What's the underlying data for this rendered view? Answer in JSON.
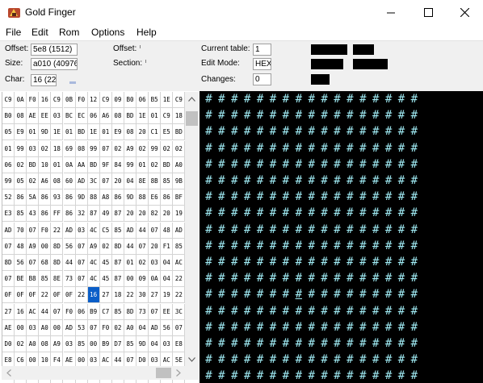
{
  "window": {
    "title": "Gold Finger",
    "minimize_icon": "minimize-icon",
    "maximize_icon": "maximize-icon",
    "close_icon": "close-icon"
  },
  "menu": [
    "File",
    "Edit",
    "Rom",
    "Options",
    "Help"
  ],
  "info": {
    "offset_label": "Offset:",
    "offset_value": "5e8 (1512)",
    "size_label": "Size:",
    "size_value": "a010 (40976)",
    "char_label": "Char:",
    "char_value": "16 (22)",
    "offset2_label": "Offset:",
    "section_label": "Section:",
    "current_table_label": "Current table:",
    "current_table_value": "1",
    "edit_mode_label": "Edit Mode:",
    "edit_mode_value": "HEX",
    "changes_label": "Changes:",
    "changes_value": "0"
  },
  "hex": {
    "rows": [
      [
        "C9",
        "0A",
        "F0",
        "16",
        "C9",
        "0B",
        "F0",
        "12",
        "C9",
        "09",
        "B0",
        "06",
        "B5",
        "1E",
        "C9"
      ],
      [
        "B0",
        "08",
        "AE",
        "EE",
        "03",
        "BC",
        "EC",
        "06",
        "A6",
        "08",
        "BD",
        "1E",
        "01",
        "C9",
        "18"
      ],
      [
        "05",
        "E9",
        "01",
        "9D",
        "1E",
        "01",
        "BD",
        "1E",
        "01",
        "E9",
        "08",
        "20",
        "C1",
        "E5",
        "BD"
      ],
      [
        "01",
        "99",
        "03",
        "02",
        "18",
        "69",
        "08",
        "99",
        "07",
        "02",
        "A9",
        "02",
        "99",
        "02",
        "02"
      ],
      [
        "06",
        "02",
        "BD",
        "10",
        "01",
        "0A",
        "AA",
        "BD",
        "9F",
        "84",
        "99",
        "01",
        "02",
        "BD",
        "A0"
      ],
      [
        "99",
        "05",
        "02",
        "A6",
        "08",
        "60",
        "AD",
        "3C",
        "07",
        "20",
        "04",
        "8E",
        "8B",
        "85",
        "9B"
      ],
      [
        "52",
        "86",
        "5A",
        "86",
        "93",
        "86",
        "9D",
        "88",
        "A8",
        "86",
        "9D",
        "88",
        "E6",
        "86",
        "BF"
      ],
      [
        "E3",
        "85",
        "43",
        "86",
        "FF",
        "86",
        "32",
        "87",
        "49",
        "87",
        "20",
        "20",
        "82",
        "20",
        "19"
      ],
      [
        "AD",
        "70",
        "07",
        "F0",
        "22",
        "AD",
        "03",
        "4C",
        "C5",
        "85",
        "AD",
        "44",
        "07",
        "48",
        "AD"
      ],
      [
        "07",
        "48",
        "A9",
        "00",
        "8D",
        "56",
        "07",
        "A9",
        "02",
        "8D",
        "44",
        "07",
        "20",
        "F1",
        "85"
      ],
      [
        "8D",
        "56",
        "07",
        "68",
        "8D",
        "44",
        "07",
        "4C",
        "45",
        "87",
        "01",
        "02",
        "03",
        "04",
        "AC"
      ],
      [
        "07",
        "BE",
        "B8",
        "85",
        "8E",
        "73",
        "07",
        "4C",
        "45",
        "87",
        "00",
        "09",
        "0A",
        "04",
        "22"
      ],
      [
        "0F",
        "0F",
        "0F",
        "22",
        "0F",
        "0F",
        "22",
        "16",
        "27",
        "18",
        "22",
        "30",
        "27",
        "19",
        "22"
      ],
      [
        "27",
        "16",
        "AC",
        "44",
        "07",
        "F0",
        "06",
        "B9",
        "C7",
        "85",
        "8D",
        "73",
        "07",
        "EE",
        "3C"
      ],
      [
        "AE",
        "00",
        "03",
        "A0",
        "00",
        "AD",
        "53",
        "07",
        "F0",
        "02",
        "A0",
        "04",
        "AD",
        "56",
        "07"
      ],
      [
        "D0",
        "02",
        "A0",
        "08",
        "A9",
        "03",
        "85",
        "00",
        "B9",
        "D7",
        "85",
        "9D",
        "04",
        "03",
        "E8"
      ],
      [
        "E8",
        "C6",
        "00",
        "10",
        "F4",
        "AE",
        "00",
        "03",
        "AC",
        "44",
        "07",
        "D0",
        "03",
        "AC",
        "5E"
      ],
      [
        "B9",
        "CF",
        "85",
        "9D",
        "04",
        "03",
        "A9",
        "3F",
        "9D",
        "01",
        "03",
        "A9",
        "10",
        "9D",
        "02"
      ]
    ],
    "selected_row": 12,
    "selected_col": 7
  },
  "text_pane": {
    "glyph": "#",
    "rows": 18,
    "cols": 17,
    "cursor_row": 12,
    "cursor_col": 7,
    "glyph_color": "#9feaf3",
    "background": "#000000"
  },
  "colors": {
    "selection": "#0a5ec8",
    "panel_bg": "#f0f0f0"
  }
}
